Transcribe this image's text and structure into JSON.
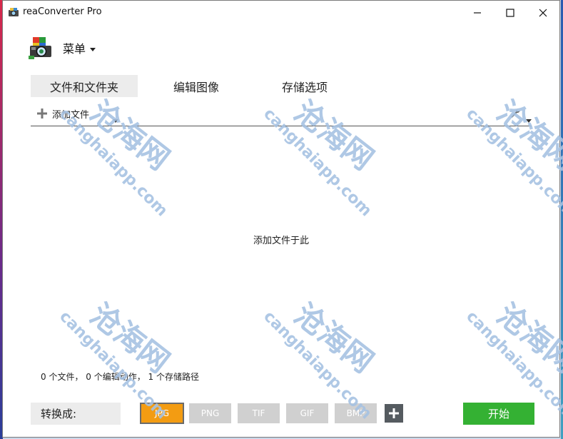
{
  "window": {
    "title": "reaConverter Pro"
  },
  "menu": {
    "label": "菜单"
  },
  "tabs": [
    {
      "label": "文件和文件夹",
      "active": true
    },
    {
      "label": "编辑图像",
      "active": false
    },
    {
      "label": "存储选项",
      "active": false
    }
  ],
  "toolbar": {
    "add_files_label": "添加文件"
  },
  "drop_area": {
    "hint": "添加文件于此"
  },
  "status": {
    "text": "0 个文件， 0 个编辑动作， 1 个存储路径"
  },
  "convert": {
    "label": "转换成:",
    "formats": [
      "JPG",
      "PNG",
      "TIF",
      "GIF",
      "BMP"
    ],
    "selected": "JPG"
  },
  "start_button": {
    "label": "开始"
  },
  "watermark": {
    "brand": "沧海网",
    "domain": "canghaiapp.com"
  },
  "colors": {
    "selected_format": "#f39c12",
    "unselected_format": "#d0d0d0",
    "start_button": "#34b133",
    "watermark": "#a6c2e2"
  }
}
